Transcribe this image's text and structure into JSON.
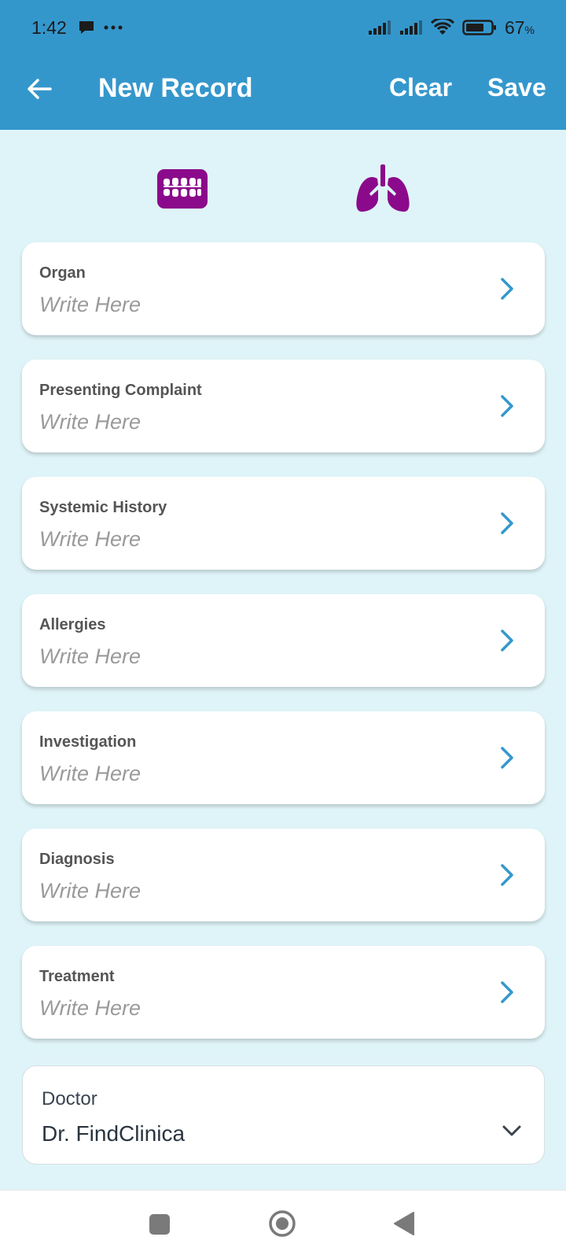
{
  "status": {
    "time": "1:42",
    "battery": "67",
    "battery_unit": "%",
    "icons": [
      "chat-bubble-icon",
      "more-dots-icon",
      "signal-icon",
      "signal-icon",
      "wifi-icon",
      "battery-icon"
    ]
  },
  "toolbar": {
    "title": "New Record",
    "clear_label": "Clear",
    "save_label": "Save",
    "back_icon": "arrow-left-icon"
  },
  "colors": {
    "appbar": "#3497cc",
    "background": "#dff4f8",
    "accent_purple": "#8b0a8b",
    "chevron_blue": "#3497cc"
  },
  "category_icons": [
    "teeth-icon",
    "lungs-icon"
  ],
  "fields": [
    {
      "label": "Organ",
      "value": "Write Here"
    },
    {
      "label": "Presenting Complaint",
      "value": "Write Here"
    },
    {
      "label": "Systemic History",
      "value": "Write Here"
    },
    {
      "label": "Allergies",
      "value": "Write Here"
    },
    {
      "label": "Investigation",
      "value": "Write Here"
    },
    {
      "label": "Diagnosis",
      "value": "Write Here"
    },
    {
      "label": "Treatment",
      "value": "Write Here"
    }
  ],
  "doctor": {
    "label": "Doctor",
    "value": "Dr. FindClinica"
  }
}
